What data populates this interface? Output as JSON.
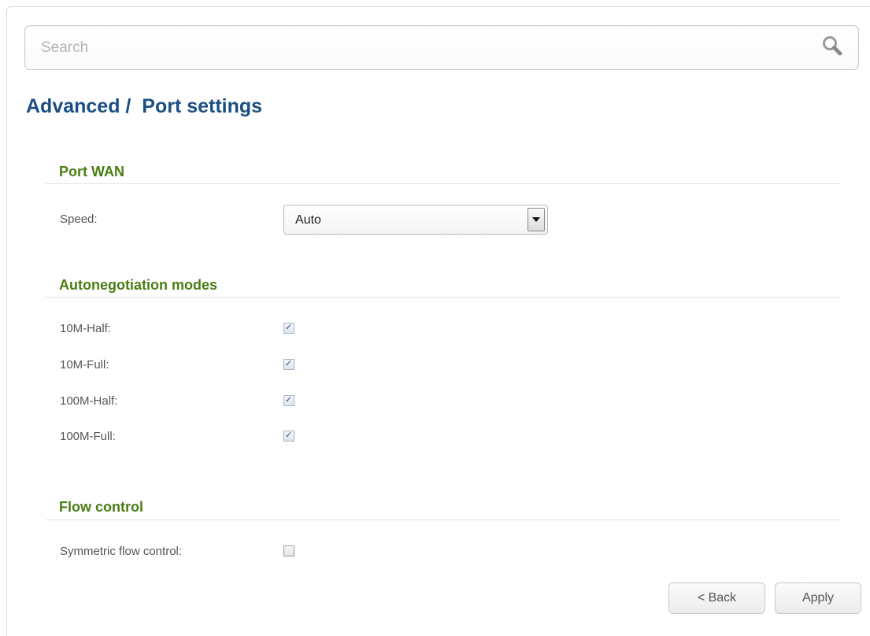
{
  "search": {
    "placeholder": "Search",
    "value": ""
  },
  "page": {
    "title": "Advanced /  Port settings"
  },
  "sections": {
    "port_wan": {
      "title": "Port WAN",
      "speed_label": "Speed:",
      "speed_value": "Auto"
    },
    "autoneg": {
      "title": "Autonegotiation modes",
      "items": [
        {
          "label": "10M-Half:",
          "checked": true
        },
        {
          "label": "10M-Full:",
          "checked": true
        },
        {
          "label": "100M-Half:",
          "checked": true
        },
        {
          "label": "100M-Full:",
          "checked": true
        }
      ]
    },
    "flow": {
      "title": "Flow control",
      "symmetric_label": "Symmetric flow control:",
      "symmetric_checked": false
    }
  },
  "buttons": {
    "back": "< Back",
    "apply": "Apply"
  },
  "colors": {
    "page_title": "#1b4f82",
    "section_title": "#4a7d14"
  },
  "icons": {
    "search": "search-icon",
    "dropdown": "chevron-down-icon",
    "check": "check-icon"
  }
}
